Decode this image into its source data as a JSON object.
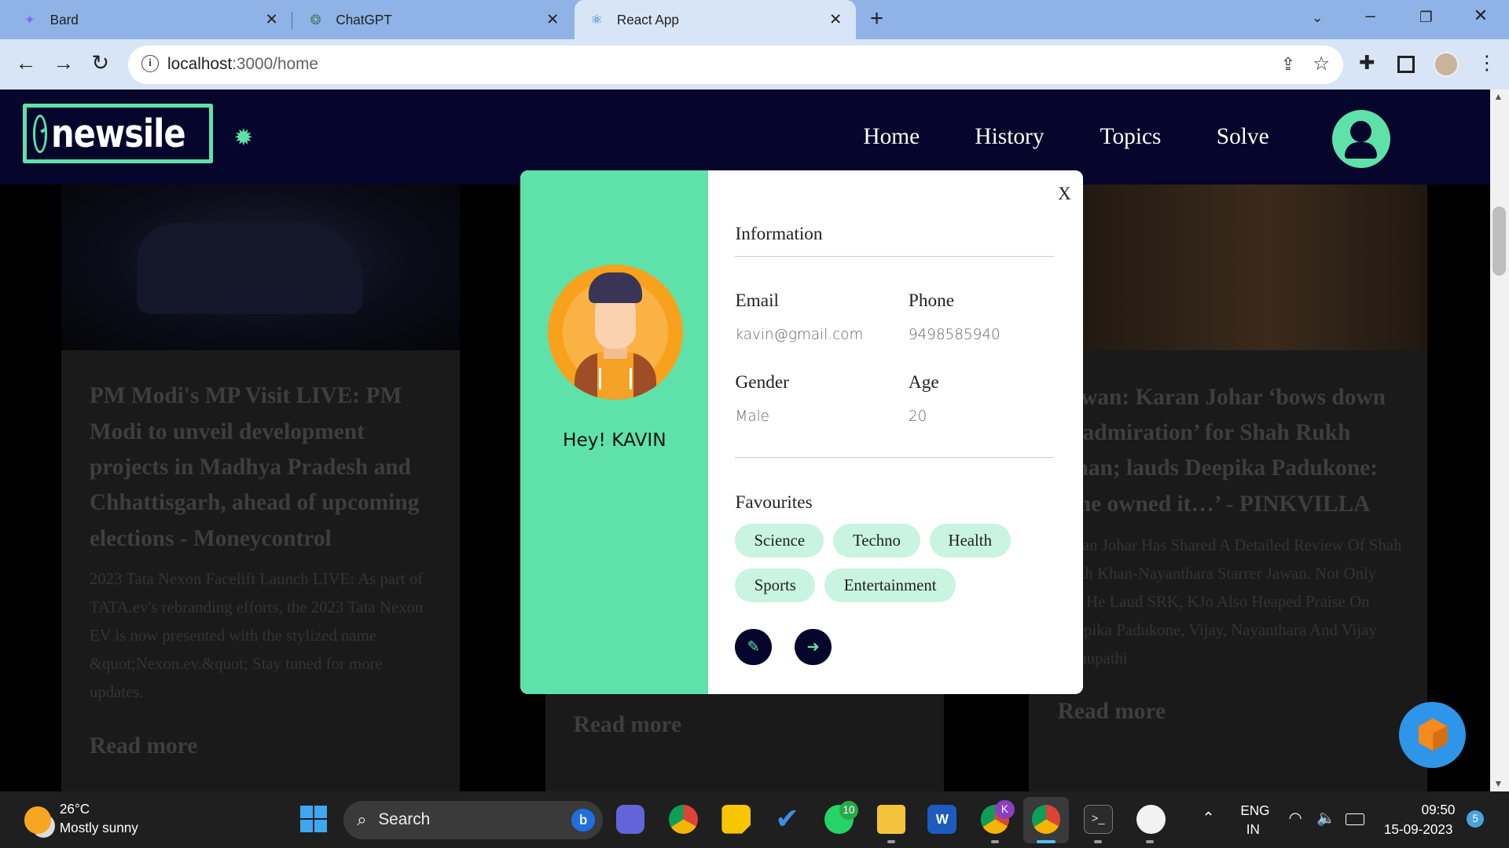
{
  "browser": {
    "tabs": [
      {
        "title": "Bard",
        "icon": "bard-icon"
      },
      {
        "title": "ChatGPT",
        "icon": "chatgpt-icon"
      },
      {
        "title": "React App",
        "icon": "react-icon"
      }
    ],
    "url_host": "localhost",
    "url_path": ":3000/home"
  },
  "header": {
    "logo_text": "newsile",
    "menu": [
      "Home",
      "History",
      "Topics",
      "Solve"
    ]
  },
  "cards": [
    {
      "title": "PM Modi's MP Visit LIVE: PM Modi to unveil development projects in Madhya Pradesh and Chhattisgarh, ahead of upcoming elections - Moneycontrol",
      "desc": "2023 Tata Nexon Facelift Launch LIVE: As part of TATA.ev's rebranding efforts, the 2023 Tata Nexon EV is now presented with the stylized name &quot;Nexon.ev.&quot; Stay tuned for more updates.",
      "more": "Read more"
    },
    {
      "more": "Read more"
    },
    {
      "title": "Jawan: Karan Johar ‘bows down in admiration’ for Shah Rukh Khan; lauds Deepika Padukone: ‘She owned it…’ - PINKVILLA",
      "desc": "Karan Johar Has Shared A Detailed Review Of Shah Rukh Khan-Nayanthara Starrer Jawan. Not Only Did He Laud SRK, KJo Also Heaped Praise On Deepika Padukone, Vijay, Nayanthara And Vijay Sethupathi",
      "more": "Read more"
    }
  ],
  "profile": {
    "greeting": "Hey! KAVIN",
    "close": "X",
    "section_title": "Information",
    "email_label": "Email",
    "email": "kavin@gmail.com",
    "phone_label": "Phone",
    "phone": "9498585940",
    "gender_label": "Gender",
    "gender": "Male",
    "age_label": "Age",
    "age": "20",
    "favourites_label": "Favourites",
    "favourites": [
      "Science",
      "Techno",
      "Health",
      "Sports",
      "Entertainment"
    ]
  },
  "taskbar": {
    "temp": "26°C",
    "condition": "Mostly sunny",
    "search": "Search",
    "whatsapp_badge": "10",
    "chrome_profile_badge": "K",
    "lang1": "ENG",
    "lang2": "IN",
    "time": "09:50",
    "date": "15-09-2023",
    "notif": "5"
  },
  "colors": {
    "accent": "#5ee2aa",
    "navy": "#06052b",
    "chip": "#c8f4e1"
  }
}
